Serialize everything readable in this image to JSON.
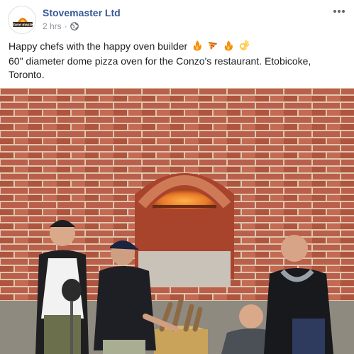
{
  "post": {
    "page_name": "Stovemaster Ltd",
    "timestamp": "2 hrs",
    "separator": "·",
    "privacy_icon": "globe-icon",
    "more_icon": "ellipsis-icon",
    "logo_text": "Stove master",
    "text_line1": "Happy chefs with the happy oven builder",
    "emojis": [
      "fire-emoji",
      "pizza-emoji",
      "fire-emoji",
      "ok-hand-emoji"
    ],
    "text_line2": "60\" diameter dome pizza oven for the Conzo's restaurant. Etobicoke, Toronto."
  },
  "photo": {
    "subject": "four men posing beside a brick dome pizza oven",
    "colors": {
      "brick": "#b5523c",
      "mortar": "#d9c3a8",
      "fire": "#e87a2a",
      "floor": "#8f8a80"
    }
  },
  "colors": {
    "link": "#385898",
    "meta": "#90949c",
    "text": "#1c1e21"
  }
}
